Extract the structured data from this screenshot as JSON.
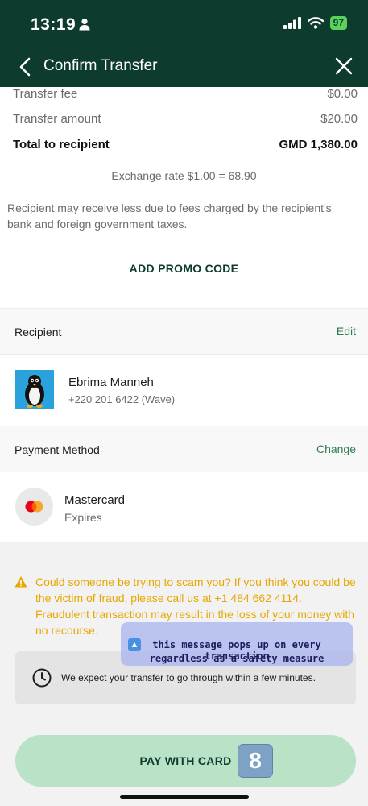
{
  "status_bar": {
    "time": "13:19",
    "battery": "97"
  },
  "nav": {
    "title": "Confirm Transfer"
  },
  "summary": {
    "fee_label": "Transfer fee",
    "fee_value": "$0.00",
    "amount_label": "Transfer amount",
    "amount_value": "$20.00",
    "total_label": "Total to recipient",
    "total_value": "GMD 1,380.00",
    "exchange_rate": "Exchange rate $1.00 = 68.90",
    "disclaimer": "Recipient may receive less due to fees charged by the recipient's bank and foreign government taxes.",
    "promo_label": "ADD PROMO CODE"
  },
  "recipient_section": {
    "heading": "Recipient",
    "action": "Edit",
    "name": "Ebrima Manneh",
    "phone": "+220 201 6422 (Wave)"
  },
  "payment_section": {
    "heading": "Payment Method",
    "action": "Change",
    "card_name": "Mastercard",
    "card_sub": "Expires"
  },
  "warning": {
    "text": "Could someone be trying to scam you? If you think you could be the victim of fraud, please call us at +1 484 662 4114. Fraudulent transaction may result in the loss of your money with no recourse."
  },
  "expectation": {
    "text": "We expect your transfer to go through within a few minutes."
  },
  "annotation": {
    "line1": "this message pops up on every transaction",
    "line2": "regardless as a safety measure"
  },
  "pay_button": {
    "label": "PAY WITH CARD",
    "badge": "8"
  },
  "colors": {
    "header_bg": "#0d3b2e",
    "accent_green": "#2e7d4f",
    "warning": "#e6a800",
    "pay_button_bg": "#b9e2c6"
  }
}
